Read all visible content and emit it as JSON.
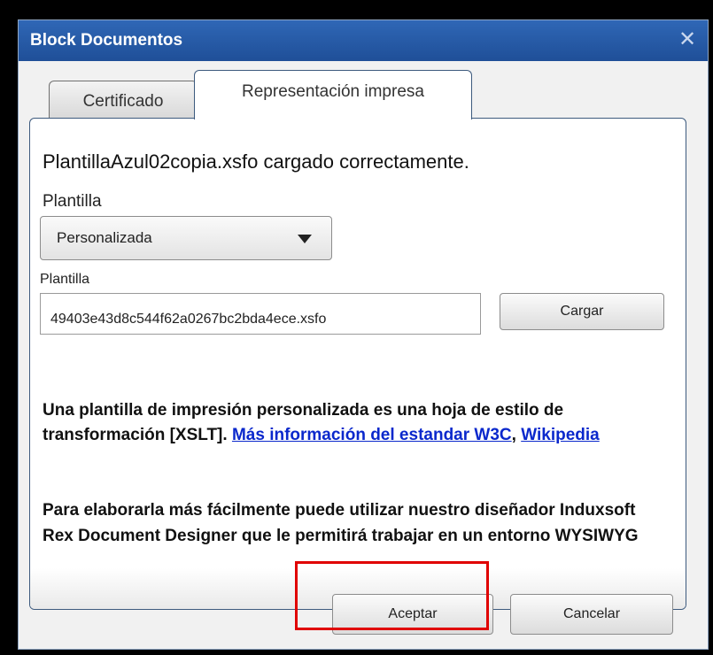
{
  "window": {
    "title": "Block Documentos",
    "close_icon": "close-icon"
  },
  "tabs": [
    {
      "label": "Certificado",
      "active": false
    },
    {
      "label": "Representación impresa",
      "active": true
    }
  ],
  "status_message": "PlantillaAzul02copia.xsfo cargado correctamente.",
  "template_select": {
    "label": "Plantilla",
    "value": "Personalizada",
    "icon": "chevron-down-icon"
  },
  "template_file": {
    "label": "Plantilla",
    "value": "49403e43d8c544f62a0267bc2bda4ece.xsfo",
    "button_label": "Cargar"
  },
  "description": {
    "text": "Una plantilla de impresión personalizada es una hoja de estilo de transformación [XSLT].",
    "link1": "Más información del estandar W3C",
    "separator": ",",
    "link2": "Wikipedia",
    "paragraph2": "Para elaborarla más fácilmente puede utilizar nuestro diseñador Induxsoft Rex Document Designer que le permitirá trabajar en un entorno WYSIWYG"
  },
  "footer": {
    "accept_label": "Aceptar",
    "cancel_label": "Cancelar"
  },
  "colors": {
    "titlebar": "#2f67b6",
    "link": "#0a28cc",
    "highlight": "#e00000"
  }
}
